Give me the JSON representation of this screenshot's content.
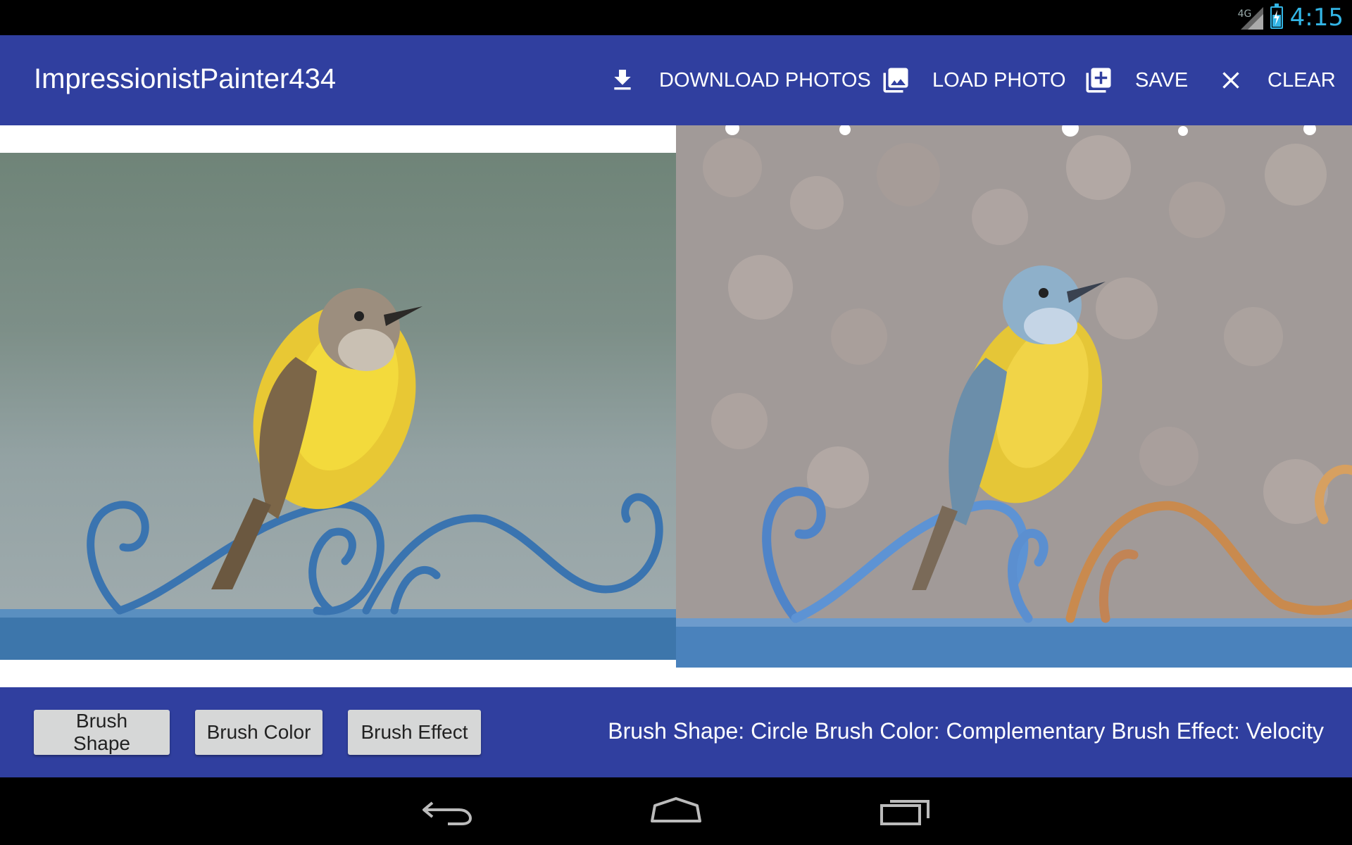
{
  "status_bar": {
    "network": "4G",
    "time": "4:15",
    "icons": [
      "signal-icon",
      "battery-charging-icon"
    ]
  },
  "app_bar": {
    "title": "ImpressionistPainter434",
    "actions": [
      {
        "label": "DOWNLOAD PHOTOS",
        "icon": "download-icon"
      },
      {
        "label": "LOAD PHOTO",
        "icon": "photo-library-icon"
      },
      {
        "label": "SAVE",
        "icon": "library-add-icon"
      },
      {
        "label": "CLEAR",
        "icon": "close-icon"
      }
    ]
  },
  "bottom_bar": {
    "buttons": [
      {
        "label": "Brush Shape"
      },
      {
        "label": "Brush Color"
      },
      {
        "label": "Brush Effect"
      }
    ],
    "status": "Brush Shape: Circle Brush Color: Complementary Brush Effect: Velocity"
  },
  "nav_bar": {
    "icons": [
      "back-icon",
      "home-icon",
      "recent-apps-icon"
    ]
  },
  "colors": {
    "primary": "#303f9f",
    "status_accent": "#33b5e5",
    "button_bg": "#d6d7d7"
  }
}
